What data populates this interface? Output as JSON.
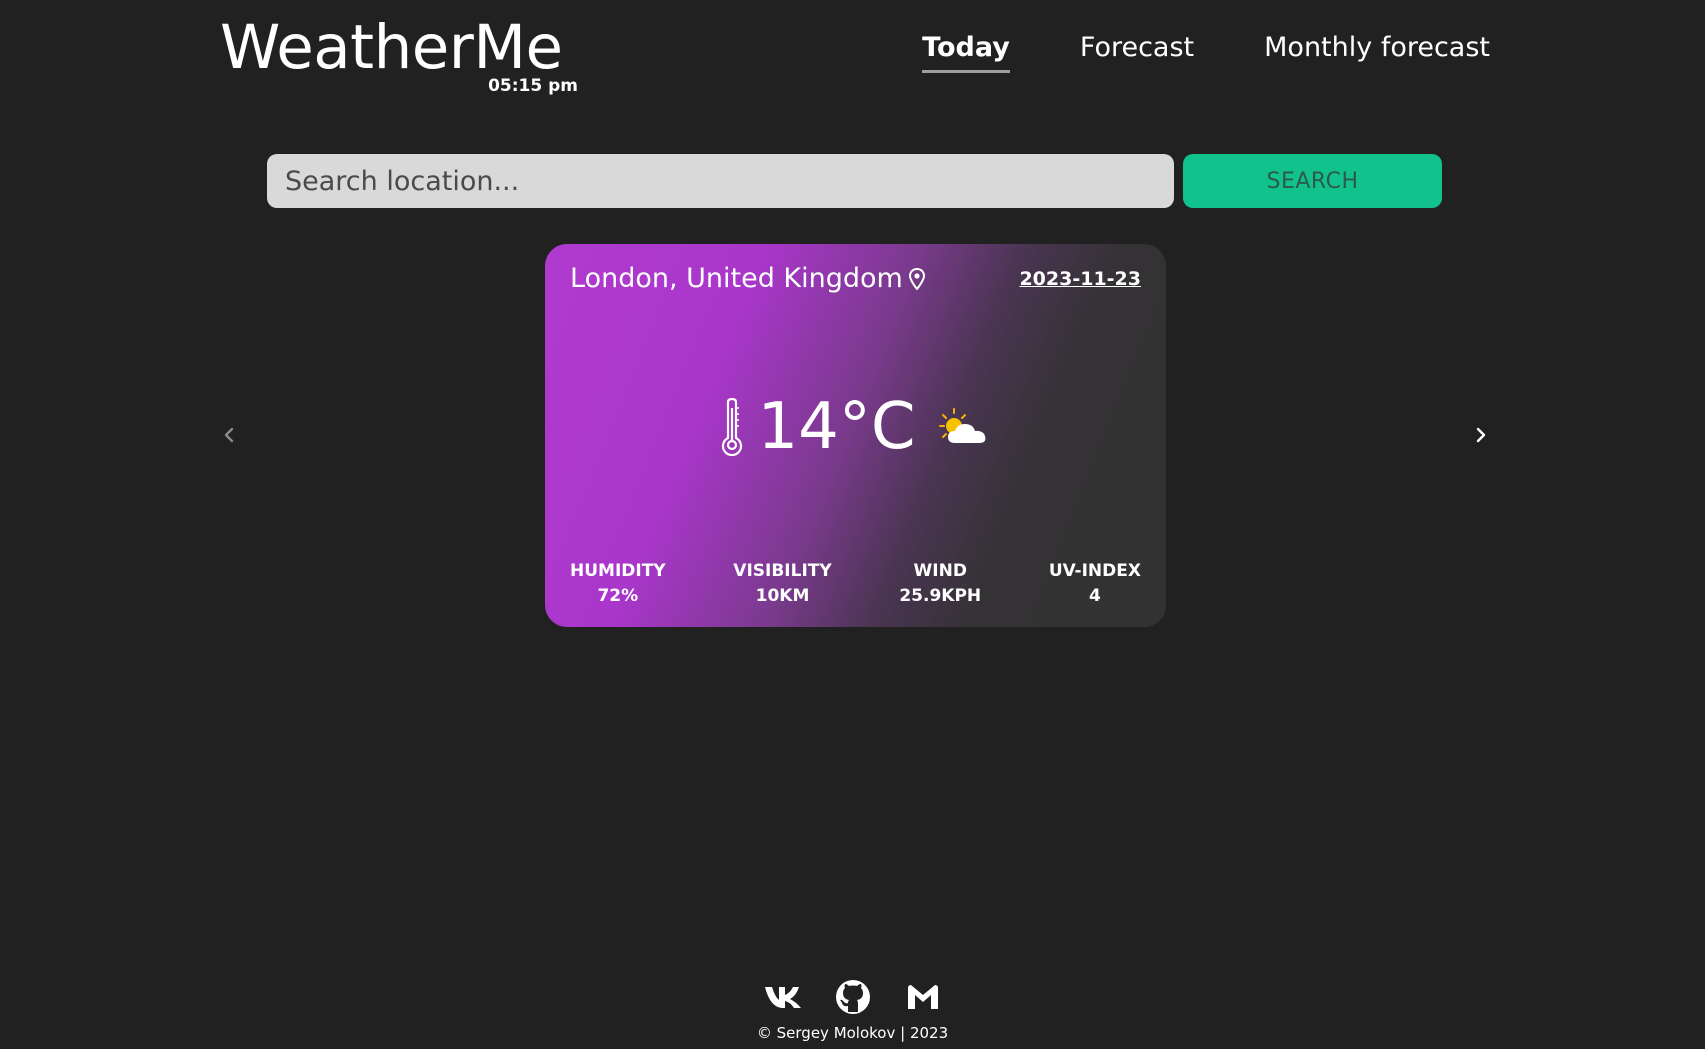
{
  "header": {
    "brand": "WeatherMe",
    "time": "05:15 pm",
    "nav": [
      {
        "label": "Today",
        "active": true
      },
      {
        "label": "Forecast",
        "active": false
      },
      {
        "label": "Monthly forecast",
        "active": false
      }
    ]
  },
  "search": {
    "placeholder": "Search location...",
    "value": "",
    "button_label": "SEARCH"
  },
  "carousel": {
    "prev_icon": "chevron-left-icon",
    "next_icon": "chevron-right-icon"
  },
  "card": {
    "location": "London, United Kingdom",
    "location_icon": "map-pin-icon",
    "date": "2023-11-23",
    "temperature": "14°C",
    "temperature_icon": "thermometer-icon",
    "condition_icon": "partly-cloudy-icon",
    "stats": [
      {
        "label": "HUMIDITY",
        "value": "72%"
      },
      {
        "label": "VISIBILITY",
        "value": "10KM"
      },
      {
        "label": "WIND",
        "value": "25.9KPH"
      },
      {
        "label": "UV-INDEX",
        "value": "4"
      }
    ]
  },
  "footer": {
    "social": [
      "vk-icon",
      "github-icon",
      "gmail-icon"
    ],
    "copyright": "© Sergey Molokov | 2023"
  },
  "colors": {
    "background": "#212121",
    "accent": "#12c28c",
    "card_gradient_start": "#b13ad0",
    "card_gradient_end": "#323232",
    "search_field": "#d9d9d9"
  }
}
